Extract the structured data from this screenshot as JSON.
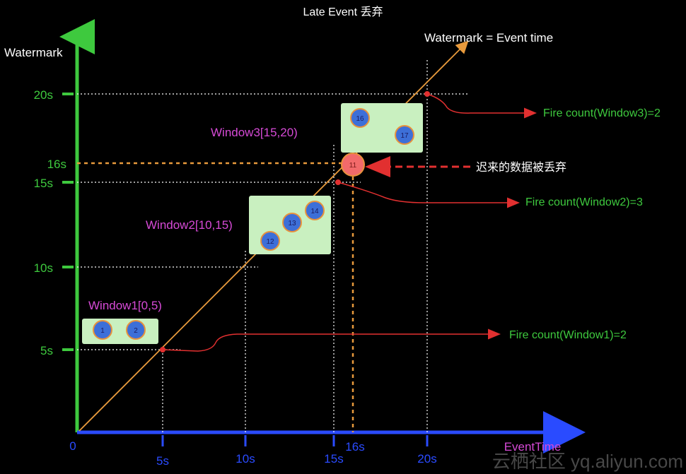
{
  "title": "Late Event 丢弃",
  "watermark_line_label": "Watermark = Event time",
  "y_axis": {
    "label": "Watermark",
    "ticks": [
      "20s",
      "16s",
      "15s",
      "10s",
      "5s"
    ]
  },
  "x_axis": {
    "label": "EventTime",
    "origin": "0",
    "ticks": [
      "5s",
      "10s",
      "15s",
      "16s",
      "20s"
    ]
  },
  "windows": [
    {
      "label": "Window1[0,5)",
      "events": [
        "1",
        "2"
      ],
      "fire": "Fire count(Window1)=2"
    },
    {
      "label": "Window2[10,15)",
      "events": [
        "12",
        "13",
        "14"
      ],
      "fire": "Fire count(Window2)=3"
    },
    {
      "label": "Window3[15,20)",
      "events": [
        "16",
        "17"
      ],
      "fire": "Fire count(Window3)=2"
    }
  ],
  "late_event": {
    "id": "11",
    "note": "迟来的数据被丢弃"
  },
  "watermark_text": "云栖社区 yq.aliyun.com",
  "colors": {
    "background": "#000000",
    "y_axis": "#3ec93e",
    "x_axis": "#2a4bff",
    "diagonal": "#e89a3c",
    "window_label": "#d64ad6",
    "window_box": "#c9f0c0",
    "event_circle": "#3d6fd8",
    "late_event": "#f26a6a",
    "fire_text": "#3ec93e",
    "fire_arrow": "#e23030"
  }
}
